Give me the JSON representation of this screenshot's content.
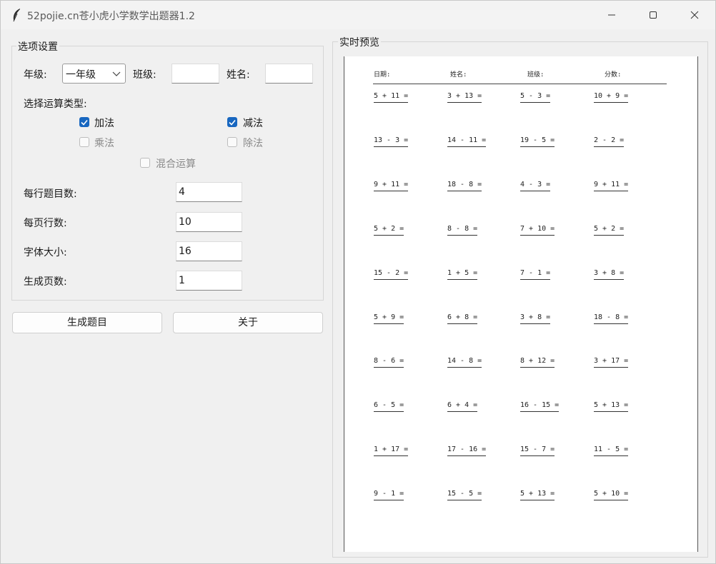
{
  "window": {
    "title": "52pojie.cn苍小虎小学数学出题器1.2"
  },
  "options": {
    "group_title": "选项设置",
    "grade_label": "年级:",
    "grade_value": "一年级",
    "class_label": "班级:",
    "class_value": "",
    "name_label": "姓名:",
    "name_value": "",
    "op_type_label": "选择运算类型:",
    "ops": {
      "add": {
        "label": "加法",
        "checked": true,
        "enabled": true
      },
      "sub": {
        "label": "减法",
        "checked": true,
        "enabled": true
      },
      "mul": {
        "label": "乘法",
        "checked": false,
        "enabled": false
      },
      "div": {
        "label": "除法",
        "checked": false,
        "enabled": false
      },
      "mixed": {
        "label": "混合运算",
        "checked": false,
        "enabled": false
      }
    },
    "per_row_label": "每行题目数:",
    "per_row_value": "4",
    "rows_label": "每页行数:",
    "rows_value": "10",
    "font_label": "字体大小:",
    "font_value": "16",
    "pages_label": "生成页数:",
    "pages_value": "1"
  },
  "buttons": {
    "generate": "生成题目",
    "about": "关于"
  },
  "preview": {
    "group_title": "实时预览",
    "headers": [
      "日期:",
      "姓名:",
      "班级:",
      "分数:"
    ],
    "rows": [
      [
        "5 + 11 =",
        "3 + 13 =",
        "5 - 3 =",
        "10 + 9 ="
      ],
      [
        "13 - 3 =",
        "14 - 11 =",
        "19 - 5 =",
        "2 - 2 ="
      ],
      [
        "9 + 11 =",
        "18 - 8 =",
        "4 - 3 =",
        "9 + 11 ="
      ],
      [
        "5 + 2 =",
        "8 - 8 =",
        "7 + 10 =",
        "5 + 2 ="
      ],
      [
        "15 - 2 =",
        "1 + 5 =",
        "7 - 1 =",
        "3 + 8 ="
      ],
      [
        "5 + 9 =",
        "6 + 8 =",
        "3 + 8 =",
        "18 - 8 ="
      ],
      [
        "8 - 6 =",
        "14 - 8 =",
        "8 + 12 =",
        "3 + 17 ="
      ],
      [
        "6 - 5 =",
        "6 + 4 =",
        "16 - 15 =",
        "5 + 13 ="
      ],
      [
        "1 + 17 =",
        "17 - 16 =",
        "15 - 7 =",
        "11 - 5 ="
      ],
      [
        "9 - 1 =",
        "15 - 5 =",
        "5 + 13 =",
        "5 + 10 ="
      ]
    ]
  },
  "colors": {
    "accent": "#1867c0",
    "background": "#f0f0f0",
    "disabled_text": "#8a8a8a"
  }
}
